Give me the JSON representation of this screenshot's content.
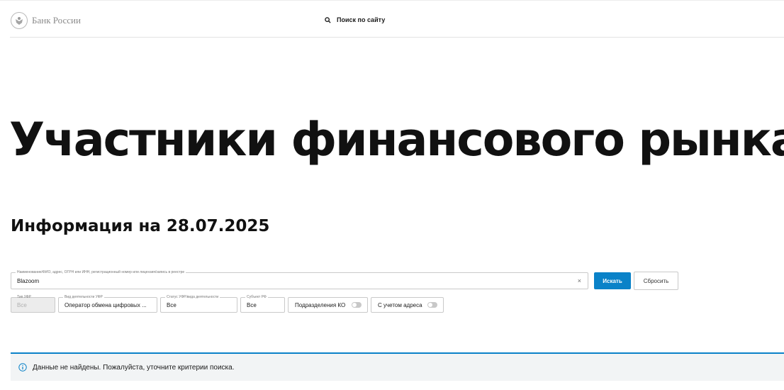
{
  "header": {
    "logo_text": "Банк России",
    "search_label": "Поиск по сайту"
  },
  "page": {
    "title": "Участники финансового рынка",
    "info_date": "Информация на 28.07.2025"
  },
  "search": {
    "label": "Наименование/ФИО, адрес, ОГРН или ИНН, регистрационный номер или лицензия/запись в реестре",
    "value": "Blazoom",
    "clear": "×",
    "submit_label": "Искать",
    "reset_label": "Сбросить"
  },
  "filters": {
    "type": {
      "label": "Тип УФР",
      "value": "Все"
    },
    "activity": {
      "label": "Вид деятельности УФР",
      "value": "Оператор обмена цифровых ..."
    },
    "status": {
      "label": "Статус УФР/вида деятельности",
      "value": "Все"
    },
    "region": {
      "label": "Субъект РФ",
      "value": "Все"
    },
    "toggle_ko": {
      "label": "Подразделения КО",
      "on": false
    },
    "toggle_address": {
      "label": "С учетом адреса",
      "on": false
    }
  },
  "notice": {
    "icon": "info-icon",
    "text": "Данные не найдены. Пожалуйста, уточните критерии поиска.",
    "accent_color": "#0a82c8"
  },
  "colors": {
    "primary": "#0a82c8",
    "notice_bg": "#f2f4f5"
  }
}
